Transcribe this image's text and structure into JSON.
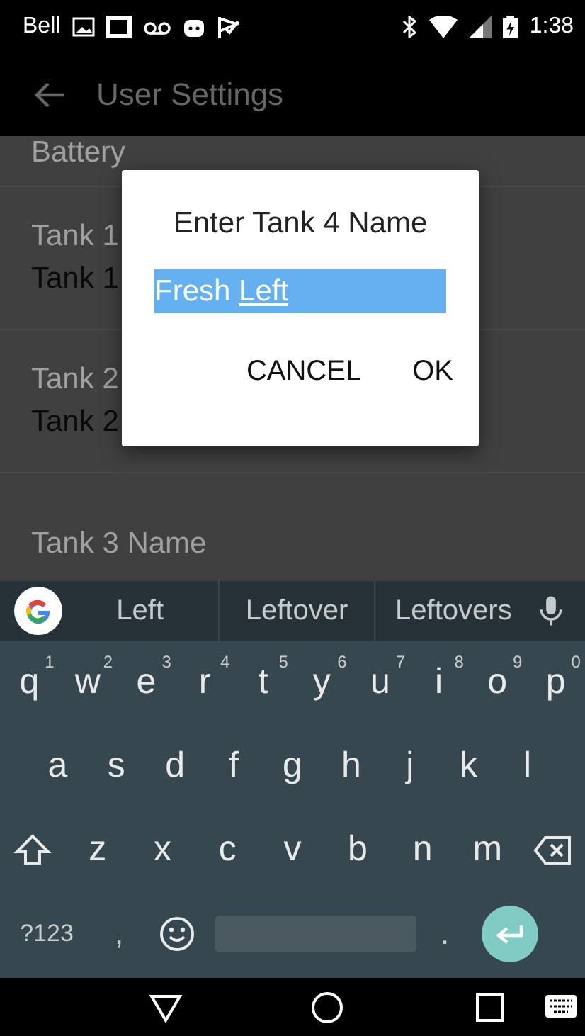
{
  "status_bar": {
    "carrier": "Bell",
    "time": "1:38"
  },
  "app_bar": {
    "title": "User Settings"
  },
  "settings_list": [
    {
      "title": "Battery"
    },
    {
      "title": "Tank 1",
      "value": "Tank 1"
    },
    {
      "title": "Tank 2",
      "value": "Tank 2"
    },
    {
      "title": "Tank 3 Name"
    }
  ],
  "dialog": {
    "title": "Enter Tank 4 Name",
    "field": {
      "selected": true,
      "value_parts": [
        {
          "text": "Fresh ",
          "underlined": false
        },
        {
          "text": "Left",
          "underlined": true
        }
      ]
    },
    "buttons": [
      "CANCEL",
      "OK"
    ]
  },
  "keyboard": {
    "suggestions": [
      "Left",
      "Leftover",
      "Leftovers"
    ],
    "rows": [
      [
        {
          "label": "q",
          "hint": "1"
        },
        {
          "label": "w",
          "hint": "2"
        },
        {
          "label": "e",
          "hint": "3"
        },
        {
          "label": "r",
          "hint": "4"
        },
        {
          "label": "t",
          "hint": "5"
        },
        {
          "label": "y",
          "hint": "6"
        },
        {
          "label": "u",
          "hint": "7"
        },
        {
          "label": "i",
          "hint": "8"
        },
        {
          "label": "o",
          "hint": "9"
        },
        {
          "label": "p",
          "hint": "0"
        }
      ],
      [
        {
          "label": "a"
        },
        {
          "label": "s"
        },
        {
          "label": "d"
        },
        {
          "label": "f"
        },
        {
          "label": "g"
        },
        {
          "label": "h"
        },
        {
          "label": "j"
        },
        {
          "label": "k"
        },
        {
          "label": "l"
        }
      ],
      [
        {
          "kind": "shift"
        },
        {
          "label": "z"
        },
        {
          "label": "x"
        },
        {
          "label": "c"
        },
        {
          "label": "v"
        },
        {
          "label": "b"
        },
        {
          "label": "n"
        },
        {
          "label": "m"
        },
        {
          "kind": "backspace"
        }
      ]
    ],
    "bottom_row": {
      "symbols": "?123",
      "comma": ",",
      "period": "."
    }
  }
}
